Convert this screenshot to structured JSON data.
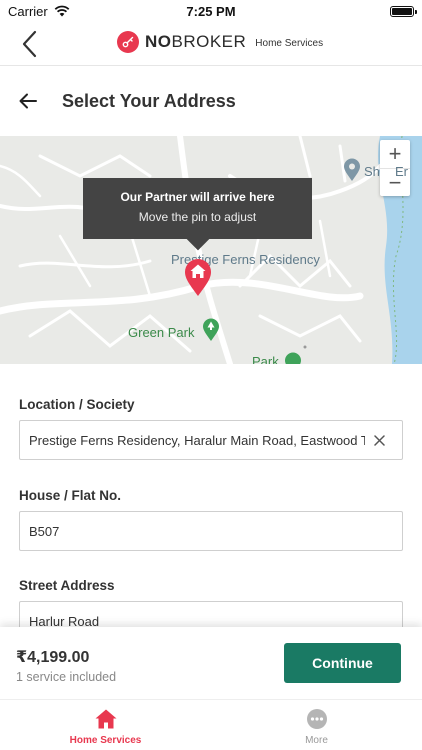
{
  "status_bar": {
    "carrier": "Carrier",
    "time": "7:25 PM"
  },
  "header": {
    "brand_bold": "NO",
    "brand_rest": "BROKER",
    "brand_sub": "Home Services"
  },
  "page": {
    "title": "Select Your Address"
  },
  "map": {
    "tooltip_title": "Our Partner will arrive here",
    "tooltip_subtitle": "Move the pin to adjust",
    "zoom_in": "+",
    "zoom_out": "−",
    "labels": {
      "residency": "Prestige Ferns Residency",
      "green_park": "Green Park",
      "park": "Park",
      "sh": "Sh",
      "er": "Er"
    }
  },
  "form": {
    "location_label": "Location / Society",
    "location_value": "Prestige Ferns Residency, Haralur Main Road, Eastwood T",
    "house_label": "House / Flat No.",
    "house_value": "B507",
    "street_label": "Street Address",
    "street_value": "Harlur Road"
  },
  "footer": {
    "price": "₹4,199.00",
    "services": "1 service included",
    "continue_label": "Continue"
  },
  "tabs": [
    {
      "label": "Home Services",
      "active": true
    },
    {
      "label": "More",
      "active": false
    }
  ],
  "colors": {
    "brand": "#e8384f",
    "primary_button": "#1a7a64",
    "tooltip": "#444444"
  }
}
